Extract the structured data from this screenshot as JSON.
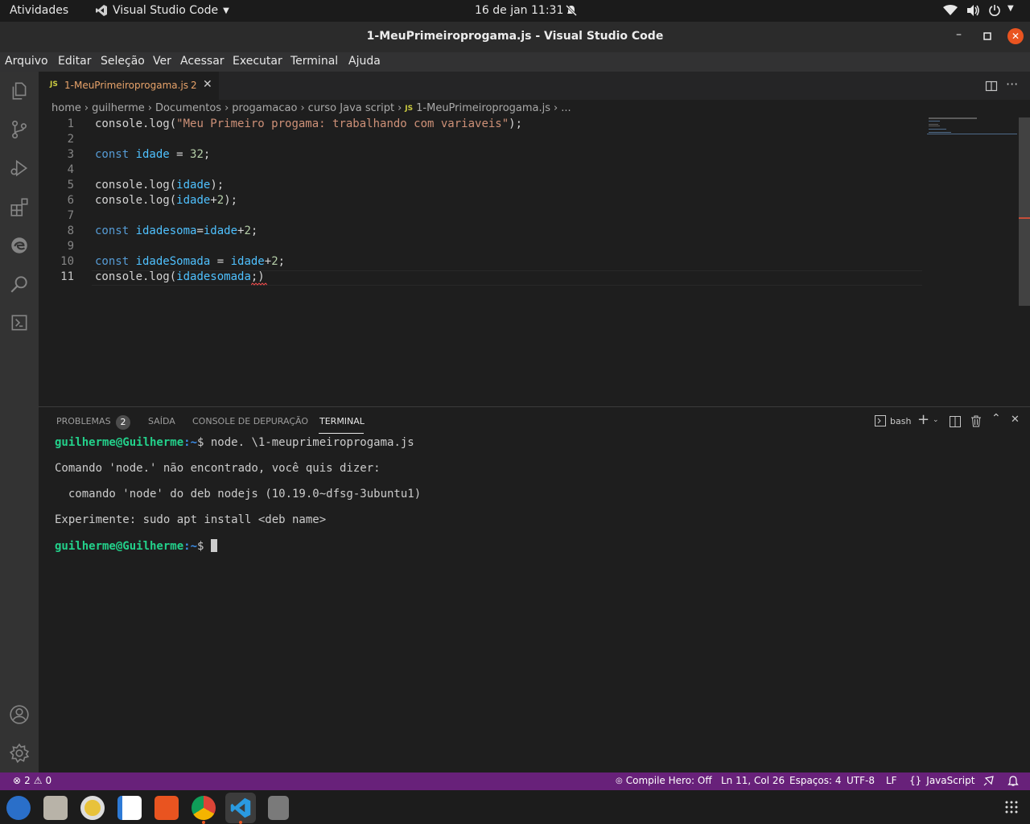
{
  "topbar": {
    "activities": "Atividades",
    "app_menu": "Visual Studio Code",
    "clock": "16 de jan  11:31"
  },
  "window": {
    "title": "1-MeuPrimeiroprogama.js - Visual Studio Code"
  },
  "menubar": {
    "items": [
      "Arquivo",
      "Editar",
      "Seleção",
      "Ver",
      "Acessar",
      "Executar",
      "Terminal",
      "Ajuda"
    ]
  },
  "activitybar": {
    "icons": [
      "files-icon",
      "source-control-icon",
      "run-debug-icon",
      "extensions-icon",
      "edge-icon",
      "search-icon",
      "remote-explorer-icon",
      "account-icon",
      "settings-gear-icon"
    ]
  },
  "editor": {
    "tab": {
      "lang_badge": "JS",
      "filename": "1-MeuPrimeiroprogama.js",
      "problems": "2"
    },
    "breadcrumb": [
      "home",
      "guilherme",
      "Documentos",
      "progamacao",
      "curso Java script"
    ],
    "breadcrumb_file": "1-MeuPrimeiroprogama.js",
    "breadcrumb_more": "...",
    "line_numbers": [
      "1",
      "2",
      "3",
      "4",
      "5",
      "6",
      "7",
      "8",
      "9",
      "10",
      "11"
    ],
    "lines": [
      [
        {
          "t": "console.log(",
          "c": ""
        },
        {
          "t": "\"Meu Primeiro progama: trabalhando com variaveis\"",
          "c": "str"
        },
        {
          "t": ");",
          "c": ""
        }
      ],
      [],
      [
        {
          "t": "const ",
          "c": "kw"
        },
        {
          "t": "idade",
          "c": "var"
        },
        {
          "t": " = ",
          "c": ""
        },
        {
          "t": "32",
          "c": "num"
        },
        {
          "t": ";",
          "c": ""
        }
      ],
      [],
      [
        {
          "t": "console.log(",
          "c": ""
        },
        {
          "t": "idade",
          "c": "var"
        },
        {
          "t": ");",
          "c": ""
        }
      ],
      [
        {
          "t": "console.log(",
          "c": ""
        },
        {
          "t": "idade",
          "c": "var"
        },
        {
          "t": "+",
          "c": ""
        },
        {
          "t": "2",
          "c": "num"
        },
        {
          "t": ");",
          "c": ""
        }
      ],
      [],
      [
        {
          "t": "const ",
          "c": "kw"
        },
        {
          "t": "idadesoma",
          "c": "var"
        },
        {
          "t": "=",
          "c": ""
        },
        {
          "t": "idade",
          "c": "var"
        },
        {
          "t": "+",
          "c": ""
        },
        {
          "t": "2",
          "c": "num"
        },
        {
          "t": ";",
          "c": ""
        }
      ],
      [],
      [
        {
          "t": "const ",
          "c": "kw"
        },
        {
          "t": "idadeSomada",
          "c": "var"
        },
        {
          "t": " = ",
          "c": ""
        },
        {
          "t": "idade",
          "c": "var"
        },
        {
          "t": "+",
          "c": ""
        },
        {
          "t": "2",
          "c": "num"
        },
        {
          "t": ";",
          "c": ""
        }
      ],
      [
        {
          "t": "console.log(",
          "c": ""
        },
        {
          "t": "idadesomada",
          "c": "var"
        },
        {
          "t": ";)",
          "c": ""
        }
      ]
    ]
  },
  "panel": {
    "tabs": [
      "PROBLEMAS",
      "SAÍDA",
      "CONSOLE DE DEPURAÇÃO",
      "TERMINAL"
    ],
    "problems_count": "2",
    "active_tab": "TERMINAL",
    "shell": "bash",
    "terminal": {
      "prompt_user": "guilherme@Guilherme",
      "prompt_path": ":~",
      "prompt_sign": "$ ",
      "command": "node. \\1-meuprimeiroprogama.js",
      "out1": "Comando 'node.' não encontrado, você quis dizer:",
      "out2": "  comando 'node' do deb nodejs (10.19.0~dfsg-3ubuntu1)",
      "out3": "Experimente: sudo apt install <deb name>"
    }
  },
  "statusbar": {
    "errors": "2",
    "warnings": "0",
    "compile_hero": "Compile Hero: Off",
    "position": "Ln 11, Col 26",
    "spaces": "Espaços: 4",
    "encoding": "UTF-8",
    "eol": "LF",
    "language": "JavaScript"
  },
  "colors": {
    "statusbar": "#68217a",
    "keyword": "#569cd6",
    "variable": "#4fc1ff",
    "string": "#ce9178",
    "number": "#b5cea8",
    "prompt_user": "#23d18b"
  }
}
